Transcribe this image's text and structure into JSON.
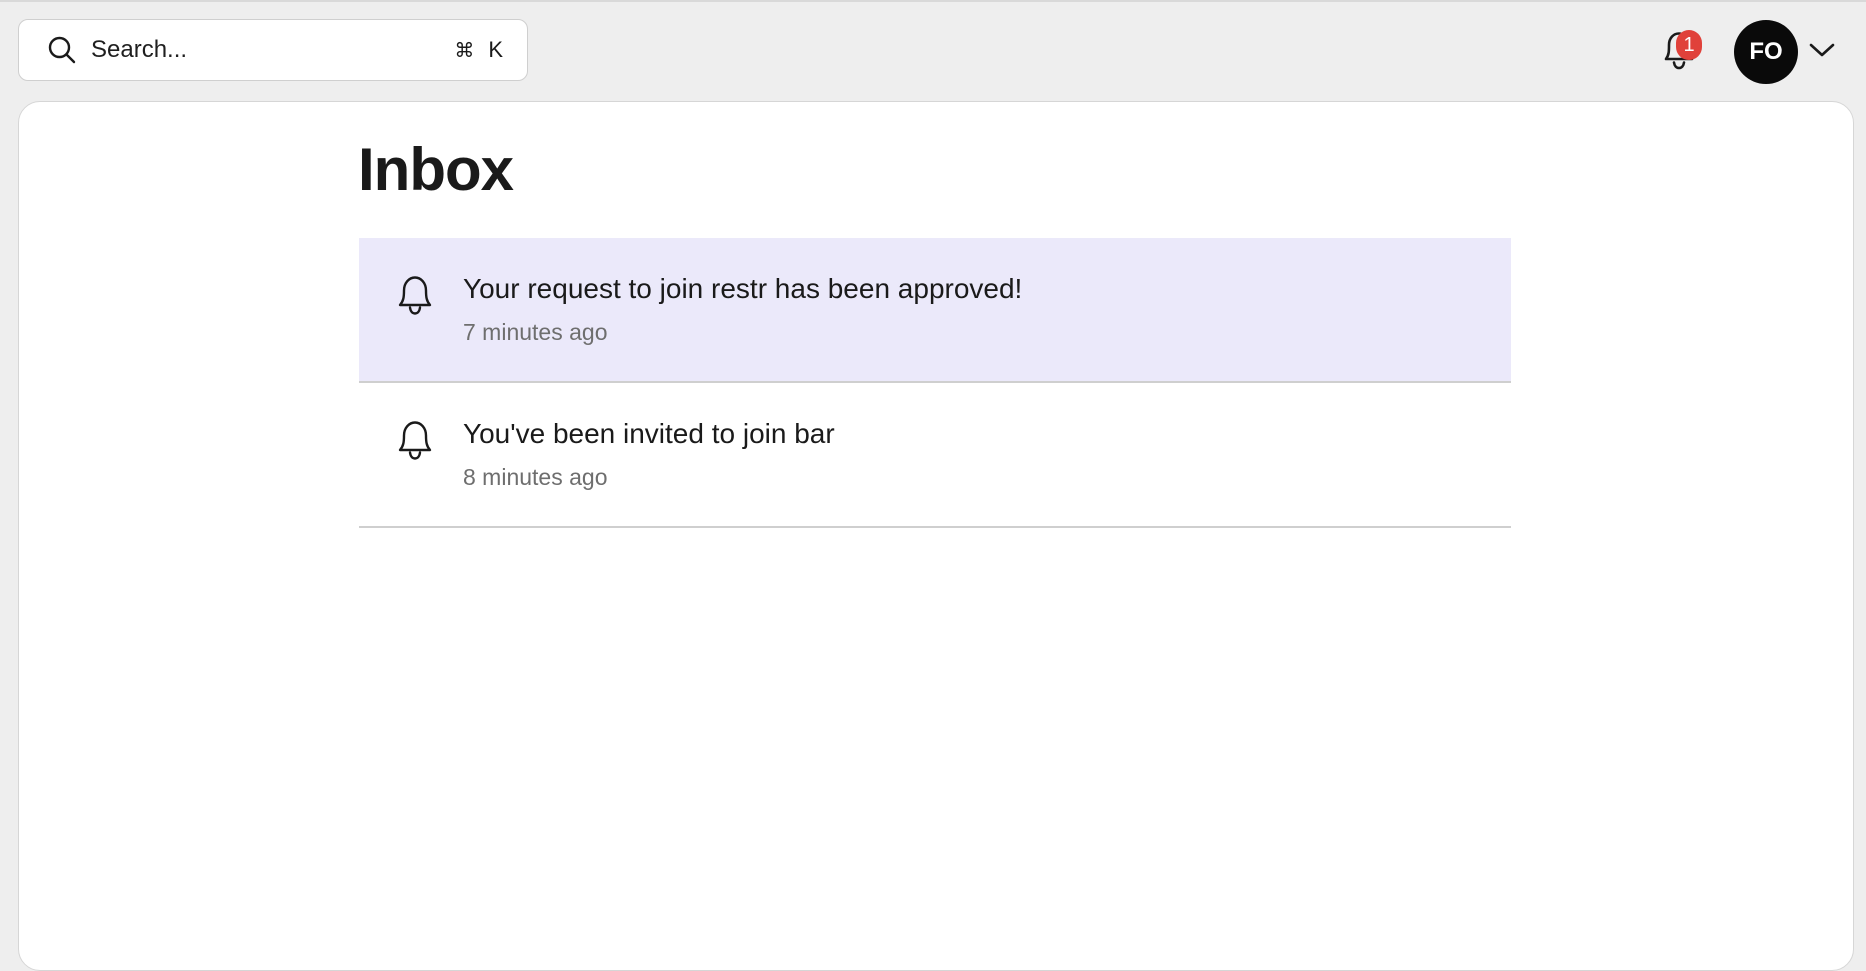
{
  "search": {
    "placeholder": "Search...",
    "shortcut_symbol": "⌘",
    "shortcut_key": "K"
  },
  "header": {
    "notification_count": "1",
    "user_initials": "FO"
  },
  "main": {
    "title": "Inbox",
    "notifications": [
      {
        "message": "Your request to join restr has been approved!",
        "time": "7 minutes ago",
        "unread": true
      },
      {
        "message": "You've been invited to join bar",
        "time": "8 minutes ago",
        "unread": false
      }
    ]
  },
  "colors": {
    "unread_background": "#ebe9fa",
    "badge": "#e0413a",
    "avatar": "#0a0a0a"
  }
}
